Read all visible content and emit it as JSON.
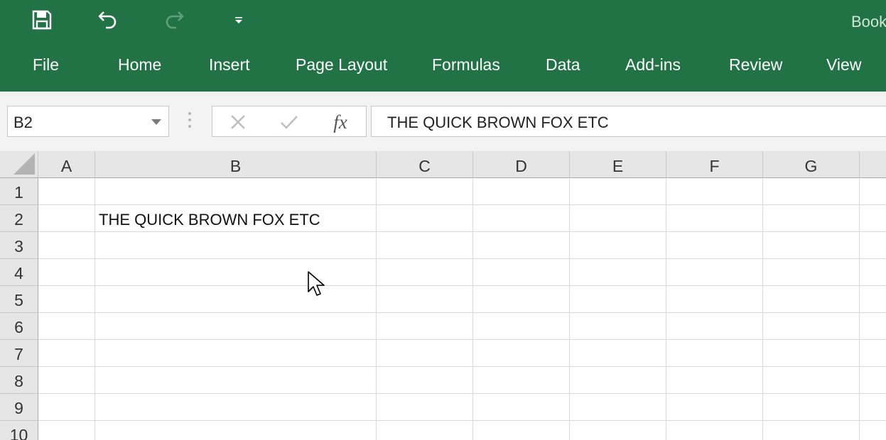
{
  "title_bar": {
    "title": "Book",
    "save_icon": "save-icon",
    "undo_icon": "undo-icon",
    "redo_icon": "redo-icon",
    "customize_icon": "customize-quick-access-icon",
    "bg_color": "#217346"
  },
  "ribbon": {
    "tabs": [
      {
        "label": "File"
      },
      {
        "label": "Home"
      },
      {
        "label": "Insert"
      },
      {
        "label": "Page Layout"
      },
      {
        "label": "Formulas"
      },
      {
        "label": "Data"
      },
      {
        "label": "Add-ins"
      },
      {
        "label": "Review"
      },
      {
        "label": "View"
      }
    ]
  },
  "formula_bar": {
    "name_box": "B2",
    "cancel_icon": "cancel-icon",
    "enter_icon": "checkmark-icon",
    "fx_label": "fx",
    "value": "THE QUICK BROWN FOX ETC"
  },
  "sheet": {
    "columns": [
      "A",
      "B",
      "C",
      "D",
      "E",
      "F",
      "G"
    ],
    "rows": [
      "1",
      "2",
      "3",
      "4",
      "5",
      "6",
      "7",
      "8",
      "9",
      "10"
    ],
    "cells": {
      "B2": "THE QUICK BROWN FOX ETC"
    },
    "active_cell": "B2"
  },
  "cursor_icon": "mouse-pointer-icon"
}
